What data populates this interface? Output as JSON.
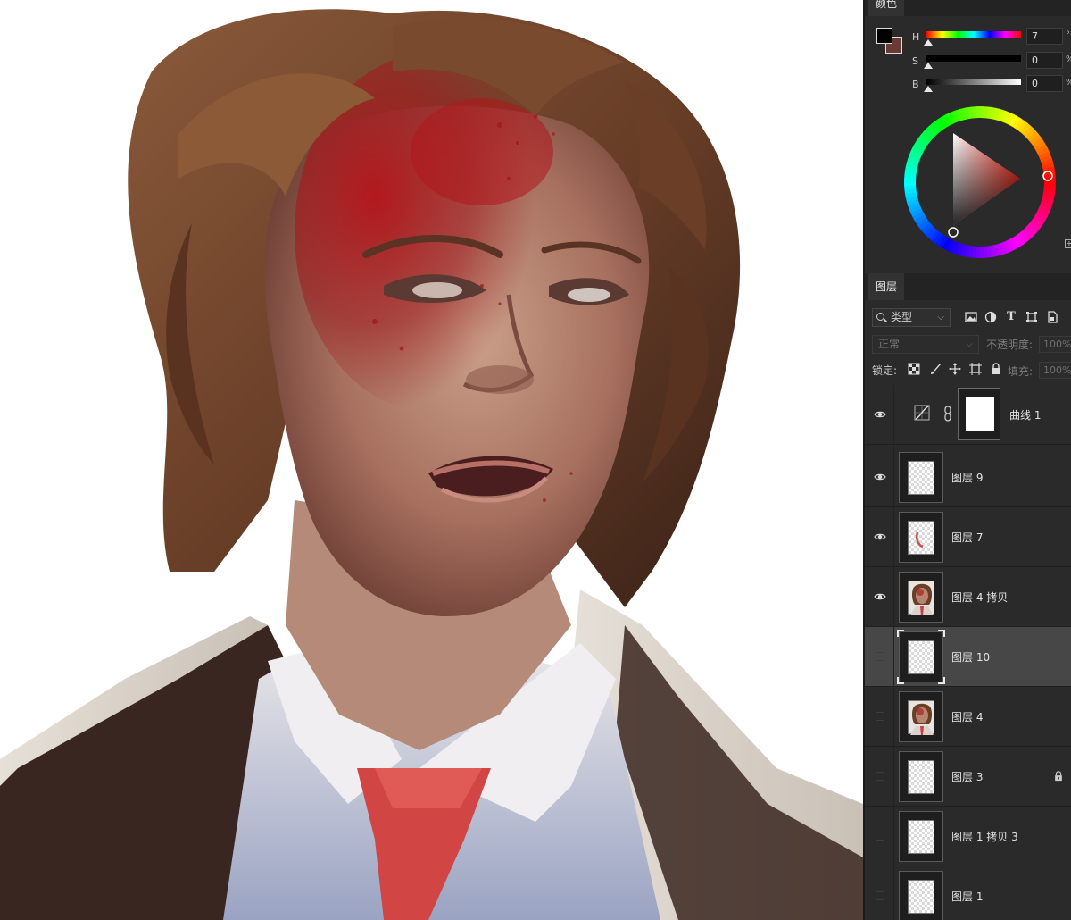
{
  "color_panel": {
    "tab_label": "颜色",
    "hsb": [
      {
        "label": "H",
        "value": "7",
        "unit": "°"
      },
      {
        "label": "S",
        "value": "0",
        "unit": "%"
      },
      {
        "label": "B",
        "value": "0",
        "unit": "%"
      }
    ],
    "foreground_color": "#000000",
    "background_color": "#6b3a35"
  },
  "layers_panel": {
    "tab_label": "图层",
    "filter_kind": "类型",
    "blend_mode": "正常",
    "opacity_label": "不透明度:",
    "opacity_value": "100%",
    "lock_label": "锁定:",
    "fill_label": "填充:",
    "fill_value": "100%",
    "layers": [
      {
        "name": "曲线 1",
        "visible": true,
        "kind": "adjustment"
      },
      {
        "name": "图层 9",
        "visible": true,
        "kind": "pixel"
      },
      {
        "name": "图层 7",
        "visible": true,
        "kind": "pixel"
      },
      {
        "name": "图层 4 拷贝",
        "visible": true,
        "kind": "portrait"
      },
      {
        "name": "图层 10",
        "visible": false,
        "kind": "pixel",
        "selected": true
      },
      {
        "name": "图层 4",
        "visible": false,
        "kind": "portrait"
      },
      {
        "name": "图层 3",
        "visible": false,
        "kind": "pixel",
        "locked": true
      },
      {
        "name": "图层 1 拷贝 3",
        "visible": false,
        "kind": "pixel"
      },
      {
        "name": "图层 1",
        "visible": false,
        "kind": "pixel"
      }
    ]
  }
}
